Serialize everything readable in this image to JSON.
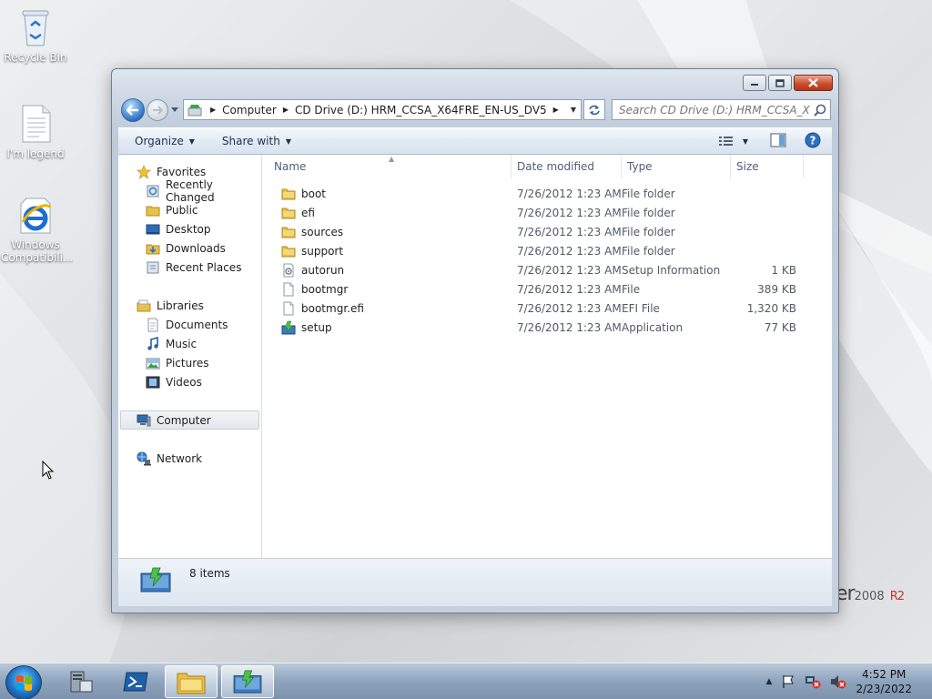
{
  "desktop": {
    "icons": [
      {
        "label": "Recycle Bin",
        "icon": "recycle-bin-icon"
      },
      {
        "label": "I'm legend",
        "icon": "text-document-icon"
      },
      {
        "label": "Windows\nCompatibili...",
        "icon": "internet-explorer-icon"
      }
    ],
    "brand": {
      "word": "er",
      "year": "2008",
      "edition": "R2"
    }
  },
  "window": {
    "address": {
      "crumbs": [
        "Computer",
        "CD Drive (D:) HRM_CCSA_X64FRE_EN-US_DV5"
      ]
    },
    "search_placeholder": "Search CD Drive (D:) HRM_CCSA_X64...",
    "commands": {
      "organize": "Organize",
      "share_with": "Share with"
    },
    "nav_pane": {
      "favorites": {
        "label": "Favorites",
        "items": [
          "Recently Changed",
          "Public",
          "Desktop",
          "Downloads",
          "Recent Places"
        ]
      },
      "libraries": {
        "label": "Libraries",
        "items": [
          "Documents",
          "Music",
          "Pictures",
          "Videos"
        ]
      },
      "computer": "Computer",
      "network": "Network"
    },
    "columns": {
      "name": "Name",
      "date": "Date modified",
      "type": "Type",
      "size": "Size"
    },
    "files": [
      {
        "name": "boot",
        "date": "7/26/2012 1:23 AM",
        "type": "File folder",
        "size": "",
        "icon": "folder-icon"
      },
      {
        "name": "efi",
        "date": "7/26/2012 1:23 AM",
        "type": "File folder",
        "size": "",
        "icon": "folder-icon"
      },
      {
        "name": "sources",
        "date": "7/26/2012 1:23 AM",
        "type": "File folder",
        "size": "",
        "icon": "folder-icon"
      },
      {
        "name": "support",
        "date": "7/26/2012 1:23 AM",
        "type": "File folder",
        "size": "",
        "icon": "folder-icon"
      },
      {
        "name": "autorun",
        "date": "7/26/2012 1:23 AM",
        "type": "Setup Information",
        "size": "1 KB",
        "icon": "setup-info-icon"
      },
      {
        "name": "bootmgr",
        "date": "7/26/2012 1:23 AM",
        "type": "File",
        "size": "389 KB",
        "icon": "file-icon"
      },
      {
        "name": "bootmgr.efi",
        "date": "7/26/2012 1:23 AM",
        "type": "EFI File",
        "size": "1,320 KB",
        "icon": "file-icon"
      },
      {
        "name": "setup",
        "date": "7/26/2012 1:23 AM",
        "type": "Application",
        "size": "77 KB",
        "icon": "setup-app-icon"
      }
    ],
    "details": {
      "item_count": "8 items"
    }
  },
  "taskbar": {
    "clock": {
      "time": "4:52 PM",
      "date": "2/23/2022"
    }
  },
  "colors": {
    "accent": "#2d74c4",
    "selection": "#e3e7ec",
    "close_button": "#c94a2b"
  }
}
